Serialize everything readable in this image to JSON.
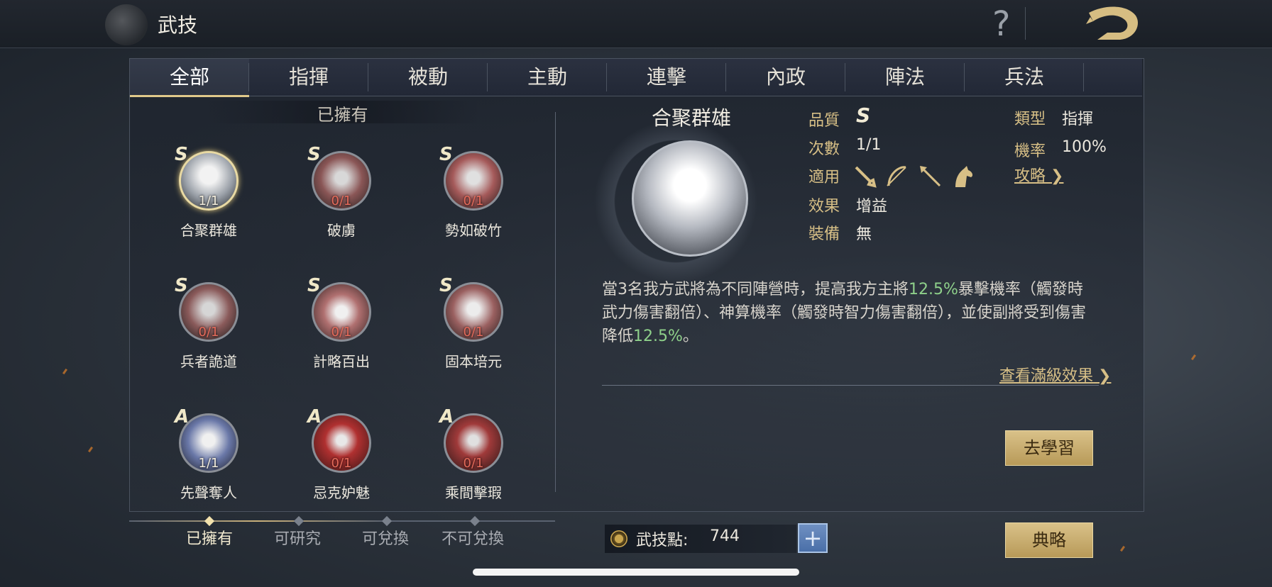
{
  "header": {
    "title": "武技",
    "help_glyph": "?",
    "back_icon": "dragon-back-icon"
  },
  "tabs": [
    {
      "label": "全部",
      "active": true
    },
    {
      "label": "指揮"
    },
    {
      "label": "被動"
    },
    {
      "label": "主動"
    },
    {
      "label": "連擊"
    },
    {
      "label": "內政"
    },
    {
      "label": "陣法"
    },
    {
      "label": "兵法"
    }
  ],
  "list": {
    "header": "已擁有",
    "skills": [
      {
        "grade": "S",
        "count": "1/1",
        "name": "合聚群雄",
        "selected": true
      },
      {
        "grade": "S",
        "count": "0/1",
        "name": "破虜"
      },
      {
        "grade": "S",
        "count": "0/1",
        "name": "勢如破竹"
      },
      {
        "grade": "S",
        "count": "0/1",
        "name": "兵者詭道"
      },
      {
        "grade": "S",
        "count": "0/1",
        "name": "計略百出"
      },
      {
        "grade": "S",
        "count": "0/1",
        "name": "固本培元"
      },
      {
        "grade": "A",
        "count": "1/1",
        "name": "先聲奪人"
      },
      {
        "grade": "A",
        "count": "0/1",
        "name": "忌克妒魅"
      },
      {
        "grade": "A",
        "count": "0/1",
        "name": "乘間擊瑕"
      }
    ]
  },
  "filters": [
    {
      "label": "已擁有",
      "active": true
    },
    {
      "label": "可研究"
    },
    {
      "label": "可兌換"
    },
    {
      "label": "不可兌換"
    }
  ],
  "points": {
    "label": "武技點:",
    "value": "744",
    "plus": "+"
  },
  "detail": {
    "title": "合聚群雄",
    "quality_label": "品質",
    "quality_value": "S",
    "times_label": "次數",
    "times_value": "1/1",
    "apply_label": "適用",
    "apply_icons": [
      "sword-icon",
      "bow-icon",
      "spear-icon",
      "horse-icon"
    ],
    "effect_label": "效果",
    "effect_value": "增益",
    "equip_label": "裝備",
    "equip_value": "無",
    "type_label": "類型",
    "type_value": "指揮",
    "rate_label": "機率",
    "rate_value": "100%",
    "guide_link": "攻略",
    "desc_part1": "當3名我方武將為不同陣營時，提高我方主將",
    "desc_hl1": "12.5%",
    "desc_part2": "暴擊機率（觸發時武力傷害翻倍）、神算機率（觸發時智力傷害翻倍），並使副將受到傷害降低",
    "desc_hl2": "12.5%",
    "desc_part3": "。",
    "full_effect_link": "查看滿級效果"
  },
  "buttons": {
    "learn": "去學習",
    "codex": "典略"
  },
  "colors": {
    "gold": "#d7bf86",
    "highlight_green": "#8ed08a",
    "count_red": "#e46a5a"
  }
}
